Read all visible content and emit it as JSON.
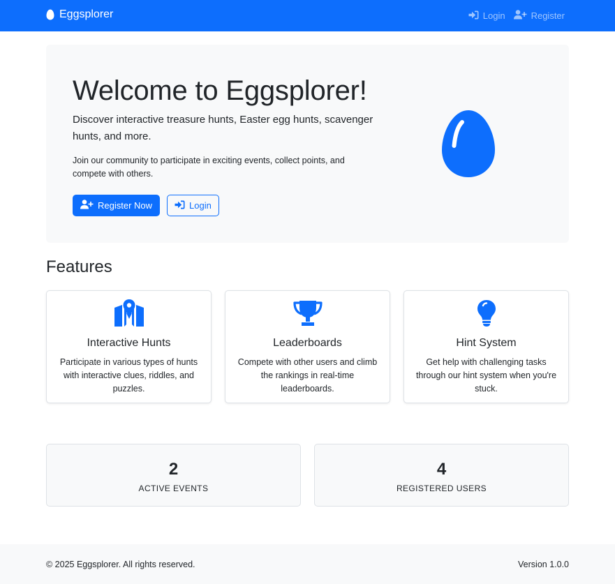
{
  "colors": {
    "primary": "#0d6efd",
    "light_bg": "#f8f9fa",
    "text": "#212529"
  },
  "navbar": {
    "brand": "Eggsplorer",
    "brand_icon": "egg-icon",
    "links": [
      {
        "label": "Login",
        "icon": "sign-in-icon"
      },
      {
        "label": "Register",
        "icon": "user-plus-icon"
      }
    ]
  },
  "hero": {
    "title": "Welcome to Eggsplorer!",
    "lead": "Discover interactive treasure hunts, Easter egg hunts, scavenger hunts, and more.",
    "text": "Join our community to participate in exciting events, collect points, and compete with others.",
    "register_button": "Register Now",
    "login_button": "Login",
    "illustration": "egg-icon"
  },
  "features": {
    "title": "Features",
    "items": [
      {
        "icon": "map-marker-icon",
        "title": "Interactive Hunts",
        "description": "Participate in various types of hunts with interactive clues, riddles, and puzzles."
      },
      {
        "icon": "trophy-icon",
        "title": "Leaderboards",
        "description": "Compete with other users and climb the rankings in real-time leaderboards."
      },
      {
        "icon": "lightbulb-icon",
        "title": "Hint System",
        "description": "Get help with challenging tasks through our hint system when you're stuck."
      }
    ]
  },
  "stats": [
    {
      "value": "2",
      "label": "ACTIVE EVENTS"
    },
    {
      "value": "4",
      "label": "REGISTERED USERS"
    }
  ],
  "footer": {
    "copyright": "© 2025 Eggsplorer. All rights reserved.",
    "version": "Version 1.0.0"
  }
}
